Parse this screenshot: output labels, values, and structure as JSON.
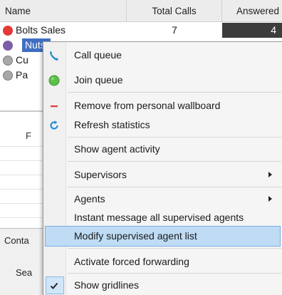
{
  "table": {
    "headers": {
      "name": "Name",
      "total_calls": "Total Calls",
      "answered": "Answered"
    },
    "rows": [
      {
        "name": "Bolts Sales",
        "total_calls": "7",
        "answered": "4",
        "status_color": "#e53935"
      },
      {
        "name": "Nuts S",
        "status_color": "#7b5ea7",
        "selected": true
      },
      {
        "name": "Cu",
        "status_color": "#a8a8a8"
      },
      {
        "name": "Pa",
        "status_color": "#a8a8a8"
      }
    ]
  },
  "background": {
    "partial_label": "F",
    "contacts_partial": "Conta",
    "search_partial": "Sea"
  },
  "context_menu": {
    "items": [
      {
        "label": "Call queue",
        "icon": "phone-icon"
      },
      {
        "label": "Join queue",
        "icon": "green-circle-icon"
      },
      {
        "label": "Remove from personal wallboard",
        "icon": "minus-icon"
      },
      {
        "label": "Refresh statistics",
        "icon": "refresh-icon"
      },
      {
        "label": "Show agent activity"
      },
      {
        "label": "Supervisors",
        "has_submenu": true
      },
      {
        "label": "Agents",
        "has_submenu": true
      },
      {
        "label": "Instant message all supervised agents"
      },
      {
        "label": "Modify supervised agent list",
        "highlighted": true
      },
      {
        "label": "Activate forced forwarding"
      },
      {
        "label": "Show gridlines",
        "checked": true,
        "icon": "checkmark-icon"
      }
    ]
  },
  "colors": {
    "selection": "#3f6fc2",
    "menu_highlight": "#bfdcf4",
    "menu_highlight_border": "#78aee5"
  }
}
